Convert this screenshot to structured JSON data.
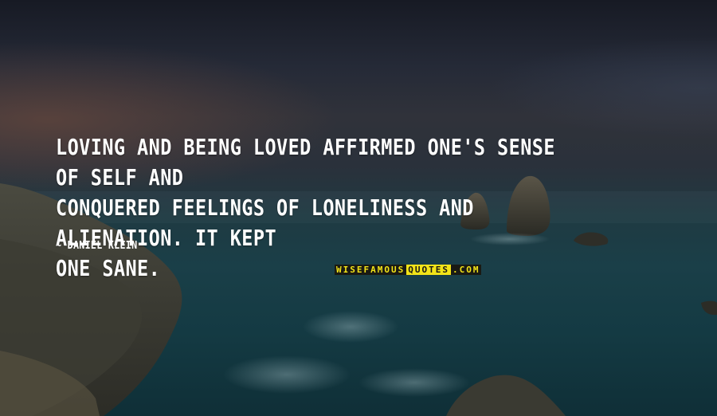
{
  "quote": {
    "lines": [
      "LOVING AND BEING LOVED AFFIRMED ONE'S SENSE OF SELF AND",
      "CONQUERED FEELINGS OF LONELINESS AND ALIENATION. IT KEPT",
      "ONE SANE."
    ]
  },
  "author": "~ DANIEL KLEIN",
  "watermark": {
    "part1": "WISEFAMOUS",
    "part2": "QUOTES",
    "part3": ".COM"
  },
  "colors": {
    "text": "#ffffff",
    "watermark_yellow": "#f2e318"
  }
}
